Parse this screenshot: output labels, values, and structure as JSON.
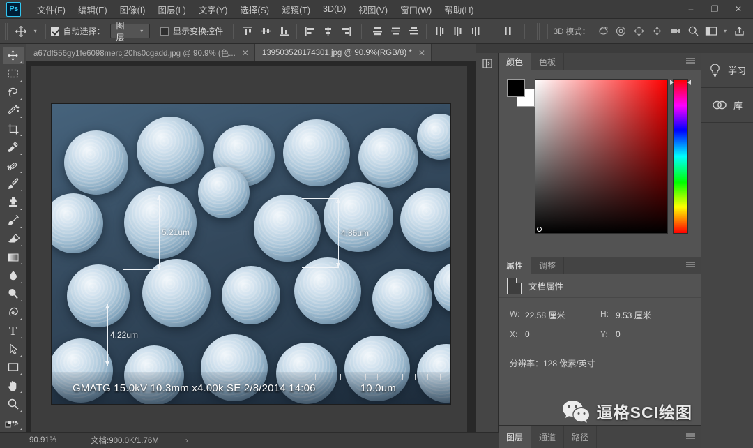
{
  "app": {
    "name": "Photoshop",
    "logo_text": "Ps"
  },
  "menubar": {
    "items": [
      {
        "label": "文件(F)"
      },
      {
        "label": "编辑(E)"
      },
      {
        "label": "图像(I)"
      },
      {
        "label": "图层(L)"
      },
      {
        "label": "文字(Y)"
      },
      {
        "label": "选择(S)"
      },
      {
        "label": "滤镜(T)"
      },
      {
        "label": "3D(D)"
      },
      {
        "label": "视图(V)"
      },
      {
        "label": "窗口(W)"
      },
      {
        "label": "帮助(H)"
      }
    ],
    "window_controls": {
      "minimize": "–",
      "maximize": "❐",
      "close": "✕"
    }
  },
  "options_bar": {
    "tool_icon": "move-tool-icon",
    "auto_select_label": "自动选择：",
    "auto_select_checked": true,
    "auto_select_value": "图层",
    "show_transform_label": "显示变换控件",
    "show_transform_checked": false,
    "mode_3d_label": "3D 模式：",
    "align_icons": [
      "align-top-edges-icon",
      "align-vertical-centers-icon",
      "align-bottom-edges-icon",
      "align-left-edges-icon",
      "align-horizontal-centers-icon",
      "align-right-edges-icon"
    ],
    "distribute_icons": [
      "distribute-top-edges-icon",
      "distribute-vertical-centers-icon",
      "distribute-bottom-edges-icon",
      "distribute-left-edges-icon",
      "distribute-horizontal-centers-icon",
      "distribute-right-edges-icon"
    ],
    "extra_icons": [
      "distribute-spacing-icon"
    ],
    "icons_3d": [
      "orbit-3d-icon",
      "roll-3d-icon",
      "pan-3d-icon",
      "slide-3d-icon",
      "camera-3d-icon"
    ],
    "right_icons": [
      "search-icon",
      "workspace-icon",
      "chevron-down-icon",
      "share-icon"
    ]
  },
  "toolbar": {
    "tools": [
      {
        "name": "move-tool",
        "active": true
      },
      {
        "name": "rectangular-marquee-tool",
        "active": false
      },
      {
        "name": "lasso-tool",
        "active": false
      },
      {
        "name": "quick-selection-tool",
        "active": false
      },
      {
        "name": "crop-tool",
        "active": false
      },
      {
        "name": "eyedropper-tool",
        "active": false
      },
      {
        "name": "healing-brush-tool",
        "active": false
      },
      {
        "name": "brush-tool",
        "active": false
      },
      {
        "name": "clone-stamp-tool",
        "active": false
      },
      {
        "name": "history-brush-tool",
        "active": false
      },
      {
        "name": "eraser-tool",
        "active": false
      },
      {
        "name": "gradient-tool",
        "active": false
      },
      {
        "name": "blur-tool",
        "active": false
      },
      {
        "name": "dodge-tool",
        "active": false
      },
      {
        "name": "pen-tool",
        "active": false
      },
      {
        "name": "type-tool",
        "active": false
      },
      {
        "name": "path-selection-tool",
        "active": false
      },
      {
        "name": "rectangle-tool",
        "active": false
      },
      {
        "name": "hand-tool",
        "active": false
      },
      {
        "name": "zoom-tool",
        "active": false
      },
      {
        "name": "edit-toolbar-tool",
        "active": false
      }
    ],
    "type_tool_glyph": "T"
  },
  "document_tabs": [
    {
      "label": "a67df556gy1fe6098mercj20hs0cgadd.jpg @ 90.9% (色...",
      "active": false,
      "close": "✕"
    },
    {
      "label": "139503528174301.jpg @ 90.9%(RGB/8) *",
      "active": true,
      "close": "✕"
    }
  ],
  "canvas": {
    "sem_image": {
      "measurements": [
        {
          "value": "5.21um",
          "id": "measurement-5-21um"
        },
        {
          "value": "4.86um",
          "id": "measurement-4-86um"
        },
        {
          "value": "4.22um",
          "id": "measurement-4-22um"
        }
      ],
      "footer_text": "GMATG 15.0kV 10.3mm x4.00k SE  2/8/2014 14:06",
      "scale_text": "10.0um"
    }
  },
  "panels": {
    "color_group": {
      "tabs": [
        {
          "label": "颜色",
          "active": true
        },
        {
          "label": "色板",
          "active": false
        }
      ],
      "foreground_color": "#000000",
      "background_color": "#ffffff"
    },
    "properties_group": {
      "tabs": [
        {
          "label": "属性",
          "active": true
        },
        {
          "label": "调整",
          "active": false
        }
      ],
      "section_title": "文档属性",
      "fields": {
        "w_key": "W:",
        "w_value": "22.58 厘米",
        "h_key": "H:",
        "h_value": "9.53 厘米",
        "x_key": "X:",
        "x_value": "0",
        "y_key": "Y:",
        "y_value": "0"
      },
      "resolution": "分辨率：128 像素/英寸"
    },
    "layers_group": {
      "tabs": [
        {
          "label": "图层",
          "active": true
        },
        {
          "label": "通道",
          "active": false
        },
        {
          "label": "路径",
          "active": false
        }
      ]
    }
  },
  "rail": {
    "items": [
      {
        "label": "学习",
        "icon": "lightbulb-icon"
      },
      {
        "label": "库",
        "icon": "creative-cloud-icon"
      }
    ]
  },
  "statusbar": {
    "zoom": "90.91%",
    "doc_size": "文档:900.0K/1.76M",
    "arrow": "›"
  },
  "watermark": {
    "text": "逼格SCI绘图",
    "icon": "wechat-icon"
  },
  "colors": {
    "accent": "#31c5f0",
    "panel_bg": "#535353",
    "chrome_bg": "#3c3c3c",
    "toolbar_bg": "#454545"
  }
}
